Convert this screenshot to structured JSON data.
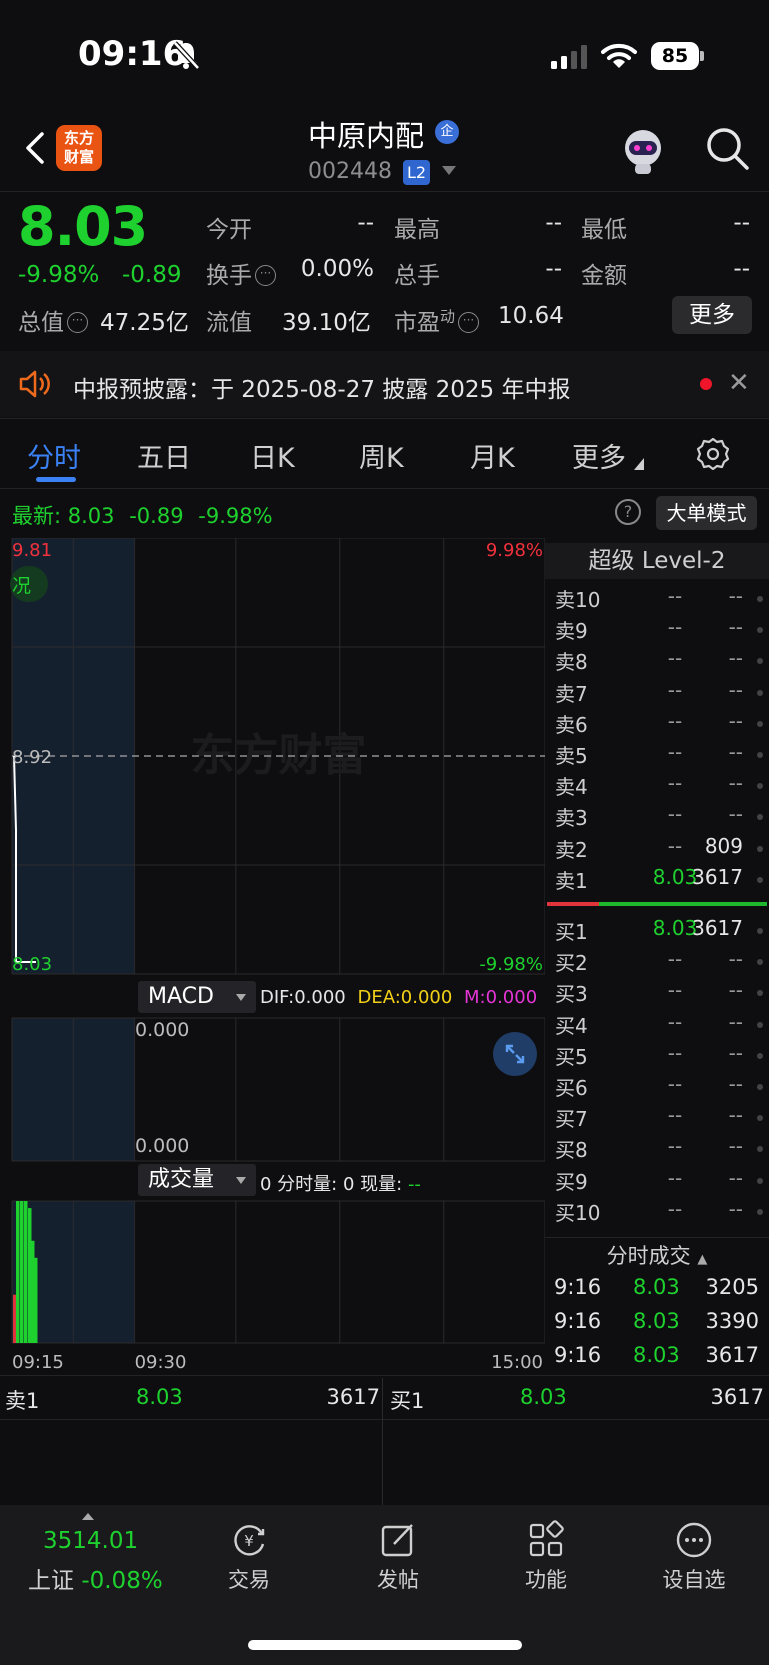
{
  "status_bar": {
    "time": "09:16",
    "battery": "85"
  },
  "header": {
    "logo_line1": "东方",
    "logo_line2": "财富",
    "stock_name": "中原内配",
    "qi_badge": "企",
    "stock_code": "002448",
    "l2_badge": "L2"
  },
  "quote": {
    "price": "8.03",
    "change_pct": "-9.98%",
    "change_abs": "-0.89",
    "fields": [
      {
        "label": "今开",
        "value": "--"
      },
      {
        "label": "最高",
        "value": "--"
      },
      {
        "label": "最低",
        "value": "--"
      },
      {
        "label": "换手",
        "value": "0.00%"
      },
      {
        "label": "总手",
        "value": "--"
      },
      {
        "label": "金额",
        "value": "--"
      },
      {
        "label": "总值",
        "value": "47.25亿"
      },
      {
        "label": "流值",
        "value": "39.10亿"
      },
      {
        "label": "市盈",
        "value": "10.64"
      }
    ],
    "pe_superscript": "动",
    "more_label": "更多"
  },
  "notice": {
    "text": "中报预披露：于 2025-08-27 披露 2025 年中报"
  },
  "tabs": [
    "分时",
    "五日",
    "日K",
    "周K",
    "月K",
    "更多"
  ],
  "latest": {
    "label": "最新:",
    "price": "8.03",
    "change": "-0.89",
    "pct": "-9.98%"
  },
  "big_order_mode": "大单模式",
  "chart_data": {
    "type": "line",
    "title": "",
    "x_ticks": [
      "09:15",
      "09:30",
      "15:00"
    ],
    "y_left_ticks": [
      "9.81",
      "8.92",
      "8.03"
    ],
    "y_right_ticks": [
      "9.98%",
      "-9.98%"
    ],
    "prev_close": 8.92,
    "ylim": [
      8.03,
      9.81
    ],
    "series": [
      {
        "x": [
          "09:15",
          "09:15",
          "09:16",
          "09:16",
          "09:16"
        ],
        "values": [
          8.92,
          8.92,
          8.6,
          8.03,
          8.03
        ]
      }
    ],
    "watermark": "东方财富",
    "side_tag": "况"
  },
  "macd": {
    "name": "MACD",
    "dif": "DIF:0.000",
    "dea": "DEA:0.000",
    "m": "M:0.000",
    "top": "0.000",
    "bottom": "0.000"
  },
  "volume": {
    "name": "成交量",
    "info_prefix": "0 分时量: 0 现量:",
    "current": "--"
  },
  "level2": {
    "title": "超级 Level-2",
    "asks": [
      {
        "label": "卖10",
        "price": "--",
        "vol": "--"
      },
      {
        "label": "卖9",
        "price": "--",
        "vol": "--"
      },
      {
        "label": "卖8",
        "price": "--",
        "vol": "--"
      },
      {
        "label": "卖7",
        "price": "--",
        "vol": "--"
      },
      {
        "label": "卖6",
        "price": "--",
        "vol": "--"
      },
      {
        "label": "卖5",
        "price": "--",
        "vol": "--"
      },
      {
        "label": "卖4",
        "price": "--",
        "vol": "--"
      },
      {
        "label": "卖3",
        "price": "--",
        "vol": "--"
      },
      {
        "label": "卖2",
        "price": "--",
        "vol": "809"
      },
      {
        "label": "卖1",
        "price": "8.03",
        "vol": "3617"
      }
    ],
    "bids": [
      {
        "label": "买1",
        "price": "8.03",
        "vol": "3617"
      },
      {
        "label": "买2",
        "price": "--",
        "vol": "--"
      },
      {
        "label": "买3",
        "price": "--",
        "vol": "--"
      },
      {
        "label": "买4",
        "price": "--",
        "vol": "--"
      },
      {
        "label": "买5",
        "price": "--",
        "vol": "--"
      },
      {
        "label": "买6",
        "price": "--",
        "vol": "--"
      },
      {
        "label": "买7",
        "price": "--",
        "vol": "--"
      },
      {
        "label": "买8",
        "price": "--",
        "vol": "--"
      },
      {
        "label": "买9",
        "price": "--",
        "vol": "--"
      },
      {
        "label": "买10",
        "price": "--",
        "vol": "--"
      }
    ],
    "ticks_title": "分时成交",
    "ticks": [
      {
        "time": "9:16",
        "price": "8.03",
        "vol": "3205"
      },
      {
        "time": "9:16",
        "price": "8.03",
        "vol": "3390"
      },
      {
        "time": "9:16",
        "price": "8.03",
        "vol": "3617"
      }
    ]
  },
  "strip": {
    "sell_label": "卖1",
    "sell_price": "8.03",
    "sell_vol": "3617",
    "buy_label": "买1",
    "buy_price": "8.03",
    "buy_vol": "3617"
  },
  "bottom_nav": {
    "index_value": "3514.01",
    "index_name": "上证",
    "index_pct": "-0.08%",
    "items": [
      "交易",
      "发帖",
      "功能",
      "设自选"
    ]
  }
}
